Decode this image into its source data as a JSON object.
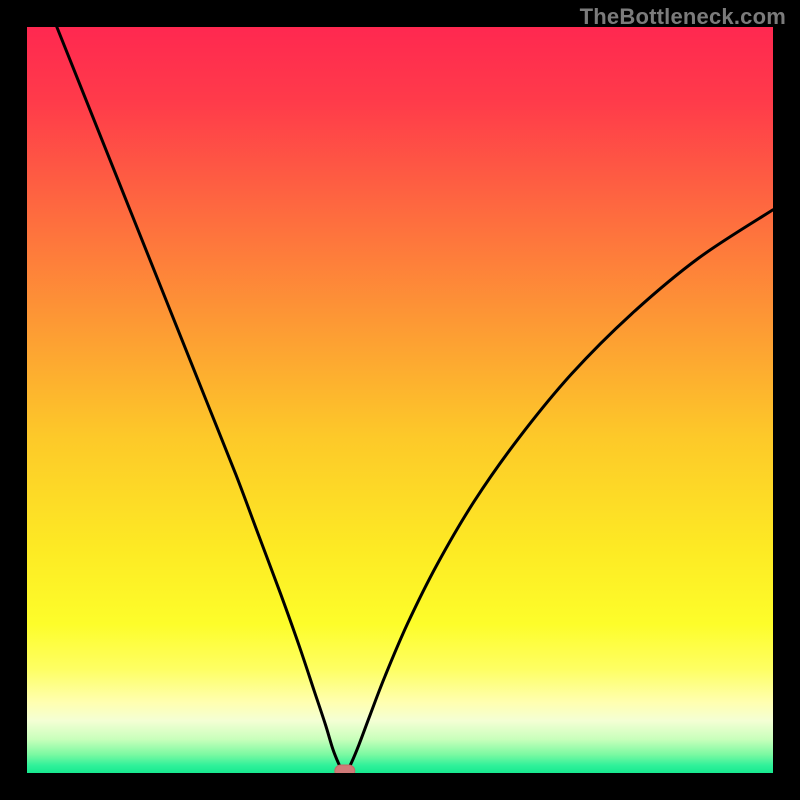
{
  "watermark": "TheBottleneck.com",
  "colors": {
    "frame": "#000000",
    "curve": "#000000",
    "marker_fill": "#cf7a78",
    "marker_stroke": "#c56866",
    "gradient_stops": [
      {
        "offset": 0.0,
        "color": "#ff2850"
      },
      {
        "offset": 0.1,
        "color": "#ff3b4a"
      },
      {
        "offset": 0.25,
        "color": "#fe6b3f"
      },
      {
        "offset": 0.4,
        "color": "#fd9a34"
      },
      {
        "offset": 0.55,
        "color": "#fdc929"
      },
      {
        "offset": 0.7,
        "color": "#fdea24"
      },
      {
        "offset": 0.8,
        "color": "#fdfd2a"
      },
      {
        "offset": 0.86,
        "color": "#feff62"
      },
      {
        "offset": 0.905,
        "color": "#ffffb0"
      },
      {
        "offset": 0.93,
        "color": "#f4ffd4"
      },
      {
        "offset": 0.955,
        "color": "#c8ffbb"
      },
      {
        "offset": 0.975,
        "color": "#7cf9a2"
      },
      {
        "offset": 0.99,
        "color": "#2ff19a"
      },
      {
        "offset": 1.0,
        "color": "#17e98f"
      }
    ]
  },
  "chart_data": {
    "type": "line",
    "title": "",
    "xlabel": "",
    "ylabel": "",
    "xlim": [
      0,
      100
    ],
    "ylim": [
      0,
      100
    ],
    "annotations": [
      "TheBottleneck.com"
    ],
    "series": [
      {
        "name": "bottleneck-curve",
        "x": [
          4,
          8,
          12,
          16,
          20,
          24,
          28,
          31,
          34,
          36.5,
          38.5,
          40,
          41,
          41.8,
          42.3,
          42.9,
          43.5,
          44.5,
          46,
          48,
          51,
          55,
          60,
          66,
          73,
          81,
          90,
          100
        ],
        "values": [
          100,
          90,
          80,
          70,
          60,
          50,
          40,
          32,
          24,
          17,
          11,
          6.5,
          3.2,
          1.2,
          0.3,
          0.3,
          1.4,
          3.8,
          7.8,
          13,
          20,
          28,
          36.5,
          45,
          53.5,
          61.5,
          69,
          75.5
        ]
      }
    ],
    "marker": {
      "x": 42.6,
      "y": 0.0,
      "label": "optimal-point"
    },
    "legend": false,
    "grid": false
  }
}
